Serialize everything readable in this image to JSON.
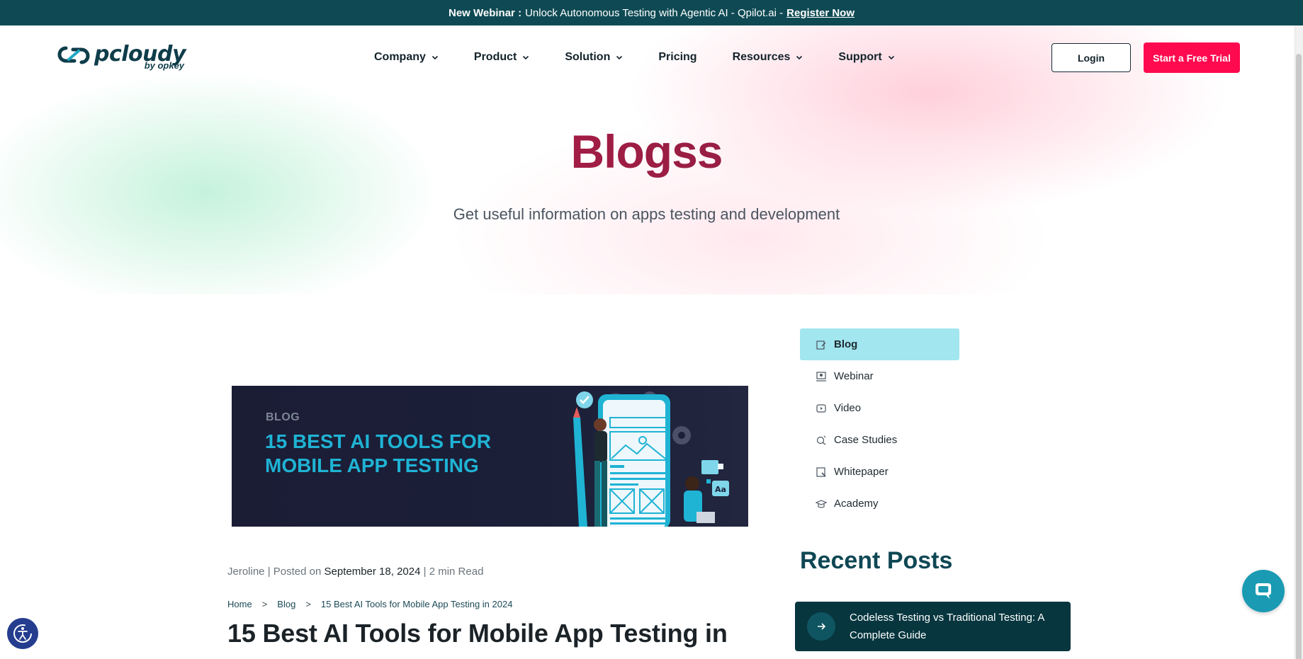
{
  "announcement": {
    "lead": "New Webinar :",
    "text": "Unlock Autonomous Testing with Agentic AI - Qpilot.ai -",
    "link": "Register Now"
  },
  "logo": {
    "wordmark": "pcloudy",
    "sub": "by opkey"
  },
  "nav": {
    "items": [
      {
        "label": "Company",
        "has_menu": true
      },
      {
        "label": "Product",
        "has_menu": true
      },
      {
        "label": "Solution",
        "has_menu": true
      },
      {
        "label": "Pricing",
        "has_menu": false
      },
      {
        "label": "Resources",
        "has_menu": true
      },
      {
        "label": "Support",
        "has_menu": true
      }
    ],
    "login": "Login",
    "trial": "Start a Free Trial"
  },
  "hero": {
    "title": "Blogss",
    "subtitle": "Get useful information on apps testing and development"
  },
  "blog_card": {
    "tag": "BLOG",
    "headline": "15 BEST AI TOOLS FOR MOBILE APP TESTING"
  },
  "post": {
    "author": "Jeroline",
    "posted_on": "Posted on",
    "date": "September 18, 2024",
    "read_time": "2 min Read",
    "breadcrumb": [
      "Home",
      "Blog",
      "15 Best AI Tools for Mobile App Testing in 2024"
    ],
    "title": "15 Best AI Tools for Mobile App Testing in"
  },
  "sidebar": {
    "categories": [
      {
        "label": "Blog",
        "icon": "blog-icon",
        "active": true
      },
      {
        "label": "Webinar",
        "icon": "webinar-icon",
        "active": false
      },
      {
        "label": "Video",
        "icon": "video-icon",
        "active": false
      },
      {
        "label": "Case Studies",
        "icon": "case-studies-icon",
        "active": false
      },
      {
        "label": "Whitepaper",
        "icon": "whitepaper-icon",
        "active": false
      },
      {
        "label": "Academy",
        "icon": "academy-icon",
        "active": false
      }
    ],
    "recent_title": "Recent Posts",
    "recent_posts": [
      "Codeless Testing vs Traditional Testing: A Complete Guide"
    ]
  },
  "colors": {
    "topbar": "#0f4a54",
    "accent_red": "#ff0a4f",
    "active_category": "#a2e6ef",
    "recent_card": "#07363f",
    "chat_button": "#1a9bb3"
  }
}
